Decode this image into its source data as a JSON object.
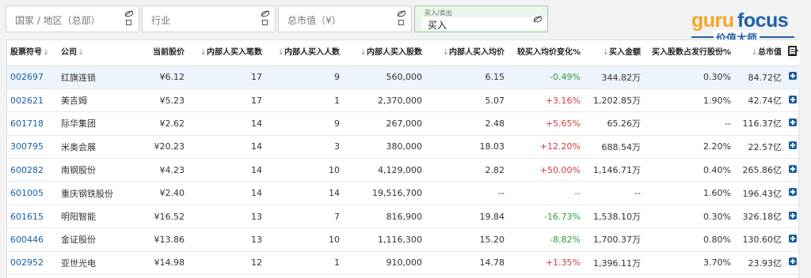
{
  "filters": {
    "country_placeholder": "国家 / 地区（总部）",
    "industry_placeholder": "行业",
    "mktcap_placeholder": "总市值（¥）",
    "trade_sublabel": "买入/卖出",
    "trade_value": "买入"
  },
  "logo": {
    "part1": "guru",
    "part2": "focus",
    "tagline": "价值大师"
  },
  "columns": [
    "股票符号",
    "公司",
    "当前股价",
    "内部人买入笔数",
    "内部人买入人数",
    "内部人买入股数",
    "内部人买入均价",
    "较买入均价变化%",
    "买入金额",
    "买入股数占发行股份%",
    "总市值"
  ],
  "rows": [
    {
      "code": "002697",
      "company": "红旗连锁",
      "price": "¥6.12",
      "count": "17",
      "people": "9",
      "shares": "560,000",
      "avg": "6.15",
      "chg": "-0.49%",
      "amount": "344.82万",
      "pct": "0.30%",
      "mktcap": "84.72亿"
    },
    {
      "code": "002621",
      "company": "美吉姆",
      "price": "¥5.23",
      "count": "17",
      "people": "1",
      "shares": "2,370,000",
      "avg": "5.07",
      "chg": "+3.16%",
      "amount": "1,202.85万",
      "pct": "1.90%",
      "mktcap": "42.74亿"
    },
    {
      "code": "601718",
      "company": "际华集团",
      "price": "¥2.62",
      "count": "14",
      "people": "9",
      "shares": "267,000",
      "avg": "2.48",
      "chg": "+5.65%",
      "amount": "65.26万",
      "pct": "--",
      "mktcap": "116.37亿"
    },
    {
      "code": "300795",
      "company": "米奥会展",
      "price": "¥20.23",
      "count": "14",
      "people": "3",
      "shares": "380,000",
      "avg": "18.03",
      "chg": "+12.20%",
      "amount": "688.54万",
      "pct": "2.20%",
      "mktcap": "22.57亿"
    },
    {
      "code": "600282",
      "company": "南钢股份",
      "price": "¥4.23",
      "count": "14",
      "people": "10",
      "shares": "4,129,000",
      "avg": "2.82",
      "chg": "+50.00%",
      "amount": "1,146.71万",
      "pct": "0.40%",
      "mktcap": "265.86亿"
    },
    {
      "code": "601005",
      "company": "重庆钢铁股份",
      "price": "¥2.40",
      "count": "14",
      "people": "14",
      "shares": "19,516,700",
      "avg": "--",
      "chg": "--",
      "amount": "--",
      "pct": "1.60%",
      "mktcap": "196.43亿"
    },
    {
      "code": "601615",
      "company": "明阳智能",
      "price": "¥16.52",
      "count": "13",
      "people": "7",
      "shares": "816,900",
      "avg": "19.84",
      "chg": "-16.73%",
      "amount": "1,538.10万",
      "pct": "0.30%",
      "mktcap": "326.18亿"
    },
    {
      "code": "600446",
      "company": "金证股份",
      "price": "¥13.86",
      "count": "13",
      "people": "10",
      "shares": "1,116,300",
      "avg": "15.20",
      "chg": "-8.82%",
      "amount": "1,700.37万",
      "pct": "0.80%",
      "mktcap": "130.60亿"
    },
    {
      "code": "002952",
      "company": "亚世光电",
      "price": "¥14.98",
      "count": "12",
      "people": "1",
      "shares": "910,000",
      "avg": "14.78",
      "chg": "+1.35%",
      "amount": "1,396.11万",
      "pct": "3.70%",
      "mktcap": "23.93亿"
    }
  ]
}
